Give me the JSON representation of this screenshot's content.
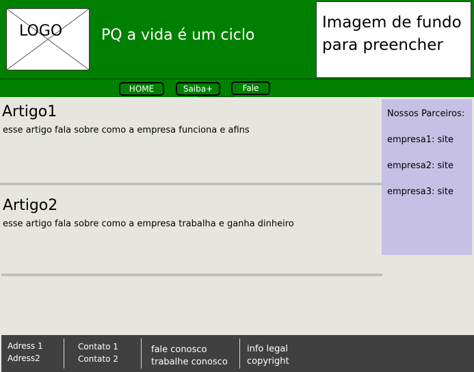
{
  "header": {
    "logo_text": "LOGO",
    "site_title": "PQ a vida é um ciclo",
    "background_placeholder": "Imagem de fundo para preencher"
  },
  "nav": {
    "items": [
      {
        "label": "HOME"
      },
      {
        "label": "Saiba+"
      },
      {
        "label": "Fale"
      }
    ]
  },
  "articles": [
    {
      "title": "Artigo1",
      "text": "esse artigo fala sobre como a empresa funciona e afins"
    },
    {
      "title": "Artigo2",
      "text": "esse artigo fala sobre como a empresa trabalha e ganha dinheiro"
    }
  ],
  "sidebar": {
    "heading": "Nossos Parceiros:",
    "items": [
      "empresa1: site",
      "empresa2: site",
      "empresa3: site"
    ]
  },
  "footer": {
    "col1": [
      "Adress 1",
      "Adress2"
    ],
    "col2": [
      "Contato 1",
      "Contato 2"
    ],
    "col3": [
      "fale conosco",
      "trabalhe conosco"
    ],
    "col4": [
      "info legal",
      "copyright"
    ]
  },
  "colors": {
    "header_bg": "#008000",
    "content_bg": "#e6e6df",
    "sidebar_bg": "#c6c0e4",
    "footer_bg": "#404040"
  }
}
